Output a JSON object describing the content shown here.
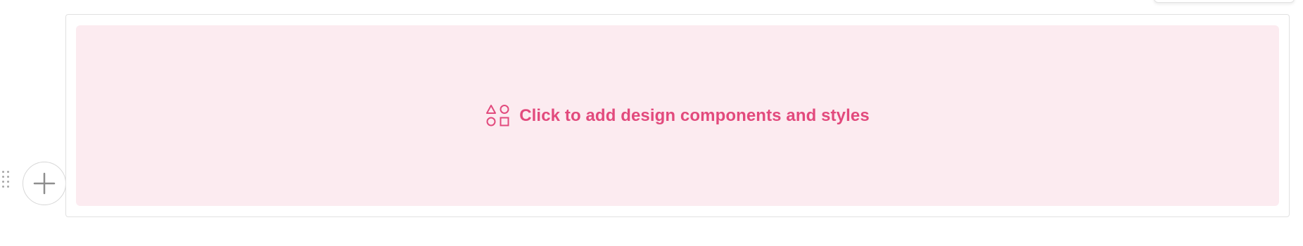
{
  "placeholder": {
    "label": "Click to add design components and styles",
    "icon": "shapes-icon",
    "accent_color": "#e24a7d",
    "background_color": "#fcebf0"
  },
  "toolbar": {
    "add_icon": "plus-icon",
    "drag_icon": "drag-handle-icon"
  }
}
